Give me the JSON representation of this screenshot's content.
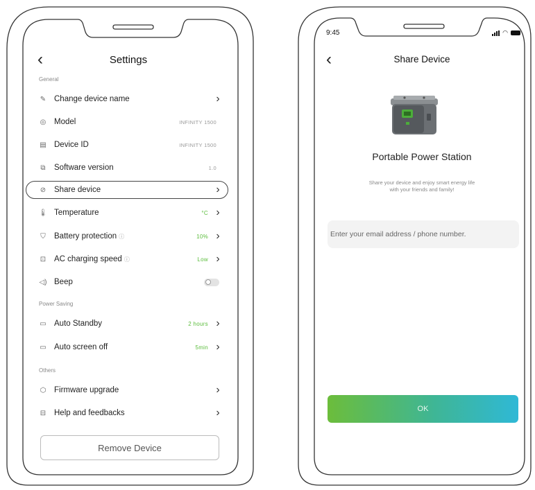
{
  "settings": {
    "title": "Settings",
    "sections": {
      "general": "General",
      "power_saving": "Power Saving",
      "others": "Others"
    },
    "rows": {
      "change_name": "Change device name",
      "model": "Model",
      "model_value": "INFINITY 1500",
      "device_id": "Device ID",
      "device_id_value": "INFINITY 1500",
      "software": "Software version",
      "software_value": "1.0",
      "share": "Share device",
      "temperature": "Temperature",
      "temperature_value": "°C",
      "battery": "Battery protection",
      "battery_value": "10%",
      "ac_speed": "AC charging speed",
      "ac_speed_value": "Low",
      "beep": "Beep",
      "auto_standby": "Auto Standby",
      "auto_standby_value": "2 hours",
      "auto_screen": "Auto screen off",
      "auto_screen_value": "5min",
      "firmware": "Firmware upgrade",
      "help": "Help and feedbacks"
    },
    "beep_on": false,
    "remove_button": "Remove Device"
  },
  "share": {
    "status_time": "9:45",
    "title": "Share Device",
    "product_name": "Portable Power Station",
    "description_line1": "Share your device and enjoy smart energy life",
    "description_line2": "with your friends and family!",
    "email_placeholder": "Enter your email address / phone number.",
    "ok_button": "OK"
  },
  "colors": {
    "accent_green": "#5bbd3c",
    "button_gradient_start": "#6cbd3b",
    "button_gradient_end": "#2fb8d6"
  }
}
